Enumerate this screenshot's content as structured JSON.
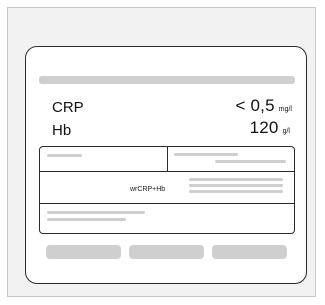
{
  "results": [
    {
      "name": "CRP",
      "value": "< 0,5",
      "unit": "mg/l"
    },
    {
      "name": "Hb",
      "value": "120",
      "unit": "g/l"
    }
  ],
  "table": {
    "middle_label": "wrCRP+Hb"
  }
}
